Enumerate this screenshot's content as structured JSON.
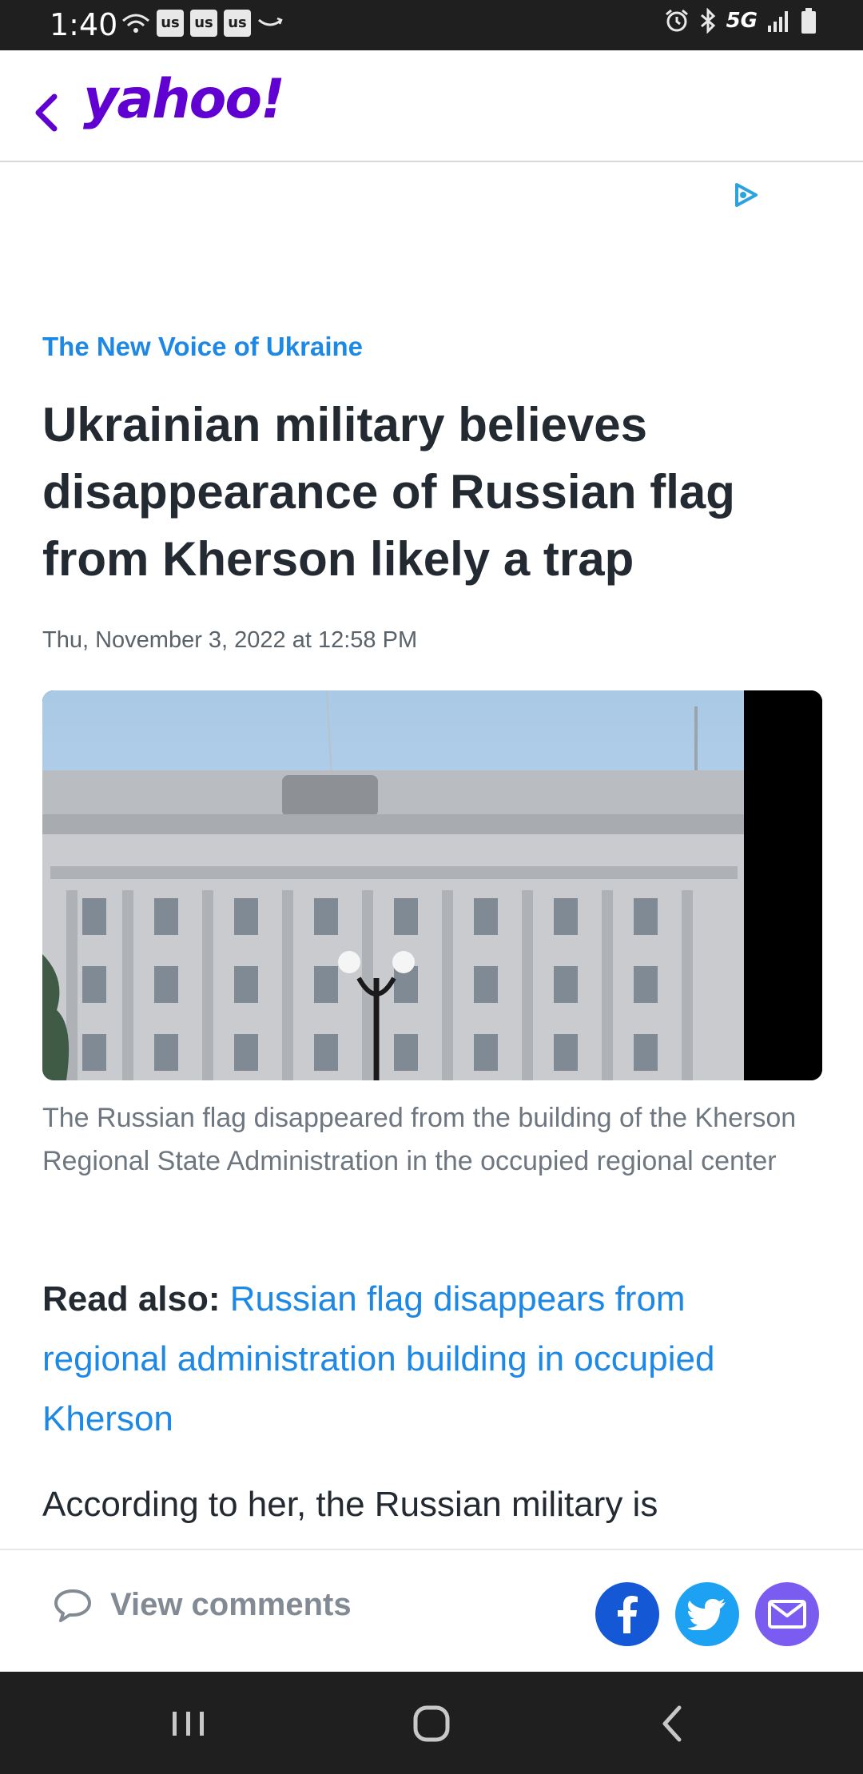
{
  "status_bar": {
    "time": "1:40",
    "notification_icons": [
      "wifi-calling-icon",
      "us-app-icon",
      "us-app-icon",
      "us-app-icon",
      "amazon-icon"
    ],
    "us_label": "us",
    "network_label": "5G",
    "right_icons": [
      "alarm-icon",
      "bluetooth-icon",
      "signal-icon",
      "battery-icon"
    ]
  },
  "header": {
    "logo": "yahoo!",
    "back_icon": "chevron-left-icon"
  },
  "ad": {
    "icon": "adchoices-icon"
  },
  "article": {
    "source": "The New Voice of Ukraine",
    "headline": "Ukrainian military believes disappearance of Russian flag from Kherson likely a trap",
    "date": "Thu, November 3, 2022 at 12:58 PM",
    "image_caption": "The Russian flag disappeared from the building of the Kherson Regional State Administration in the occupied regional center",
    "read_also_label": "Read also:",
    "read_also_link": "Russian flag disappears from regional administration building in occupied Kherson",
    "body_start": "According to her, the Russian military is"
  },
  "action_bar": {
    "comments_label": "View comments",
    "share_buttons": [
      "facebook-icon",
      "twitter-icon",
      "mail-icon"
    ]
  },
  "nav_bar": {
    "buttons": [
      "recents-icon",
      "home-icon",
      "back-icon"
    ]
  },
  "colors": {
    "yahoo_purple": "#6001d2",
    "link_blue": "#1e88e5",
    "headline_text": "#232a31",
    "facebook": "#1558d6",
    "twitter": "#1da1f2",
    "mail": "#7b5cf0"
  }
}
